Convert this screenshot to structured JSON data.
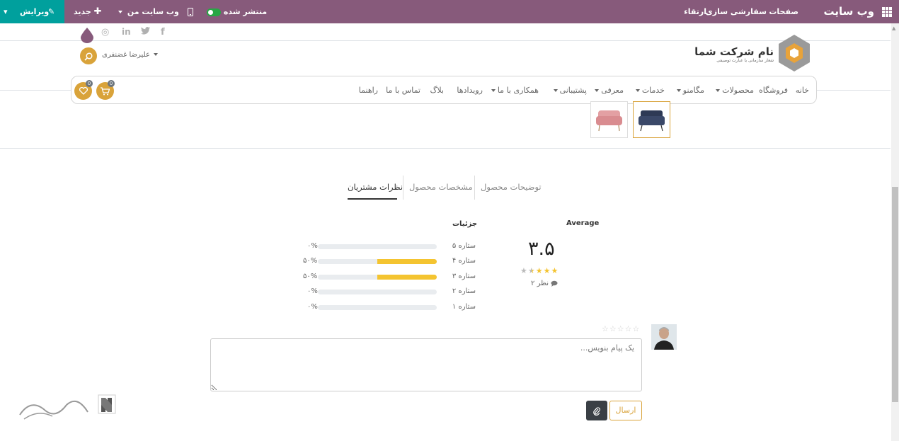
{
  "topbar": {
    "app_title": "وب سایت",
    "menu": [
      "صفحات",
      "سفارشی سازی",
      "ارتقاء"
    ],
    "published_label": "منتشر شده",
    "my_website_label": "وب سایت من",
    "new_label": "جدید",
    "edit_label": "ویرایش",
    "bg_color": "#875a7b",
    "edit_bg_color": "#00a09d"
  },
  "header": {
    "user_name": "علیرضا غضنفری",
    "company_name": "نام شرکت شما",
    "company_tagline": "شعار سازمانی یا عبارت توصیفی",
    "social_icons": [
      "facebook-icon",
      "twitter-icon",
      "linkedin-icon",
      "instagram-icon"
    ],
    "cart_count": "0",
    "wishlist_count": "0",
    "accent_color": "#d9a33a"
  },
  "nav": {
    "items": [
      {
        "label": "خانه",
        "dropdown": false
      },
      {
        "label": "فروشگاه",
        "dropdown": false
      },
      {
        "label": "محصولات",
        "dropdown": true
      },
      {
        "label": "مگامنو",
        "dropdown": true
      },
      {
        "label": "خدمات",
        "dropdown": true
      },
      {
        "label": "معرفی",
        "dropdown": true
      },
      {
        "label": "پشتیبانی",
        "dropdown": true
      },
      {
        "label": "همکاری با ما",
        "dropdown": true
      },
      {
        "label": "رویدادها",
        "dropdown": false
      },
      {
        "label": "بلاگ",
        "dropdown": false
      },
      {
        "label": "تماس با ما",
        "dropdown": false
      },
      {
        "label": "راهنما",
        "dropdown": false
      }
    ]
  },
  "tabs": {
    "description": "توضیحات محصول",
    "specs": "مشخصات محصول",
    "reviews": "نظرات مشتریان",
    "active": "reviews"
  },
  "reviews": {
    "average_label": "Average",
    "average_value": "۳.۵",
    "average_stars": 3.5,
    "review_count_text": "۲ نظر",
    "details_label": "جزئیات",
    "breakdown": [
      {
        "label": "۵ ستاره",
        "percent_text": "۰%",
        "fraction": 0
      },
      {
        "label": "۴ ستاره",
        "percent_text": "۵۰%",
        "fraction": 0.5
      },
      {
        "label": "۳ ستاره",
        "percent_text": "۵۰%",
        "fraction": 0.5
      },
      {
        "label": "۲ ستاره",
        "percent_text": "۰%",
        "fraction": 0
      },
      {
        "label": "۱ ستاره",
        "percent_text": "۰%",
        "fraction": 0
      }
    ],
    "bar_fill_color": "#f4c430"
  },
  "composer": {
    "placeholder": "یک پیام بنویس...",
    "send_label": "ارسال",
    "user_rating": 0
  }
}
